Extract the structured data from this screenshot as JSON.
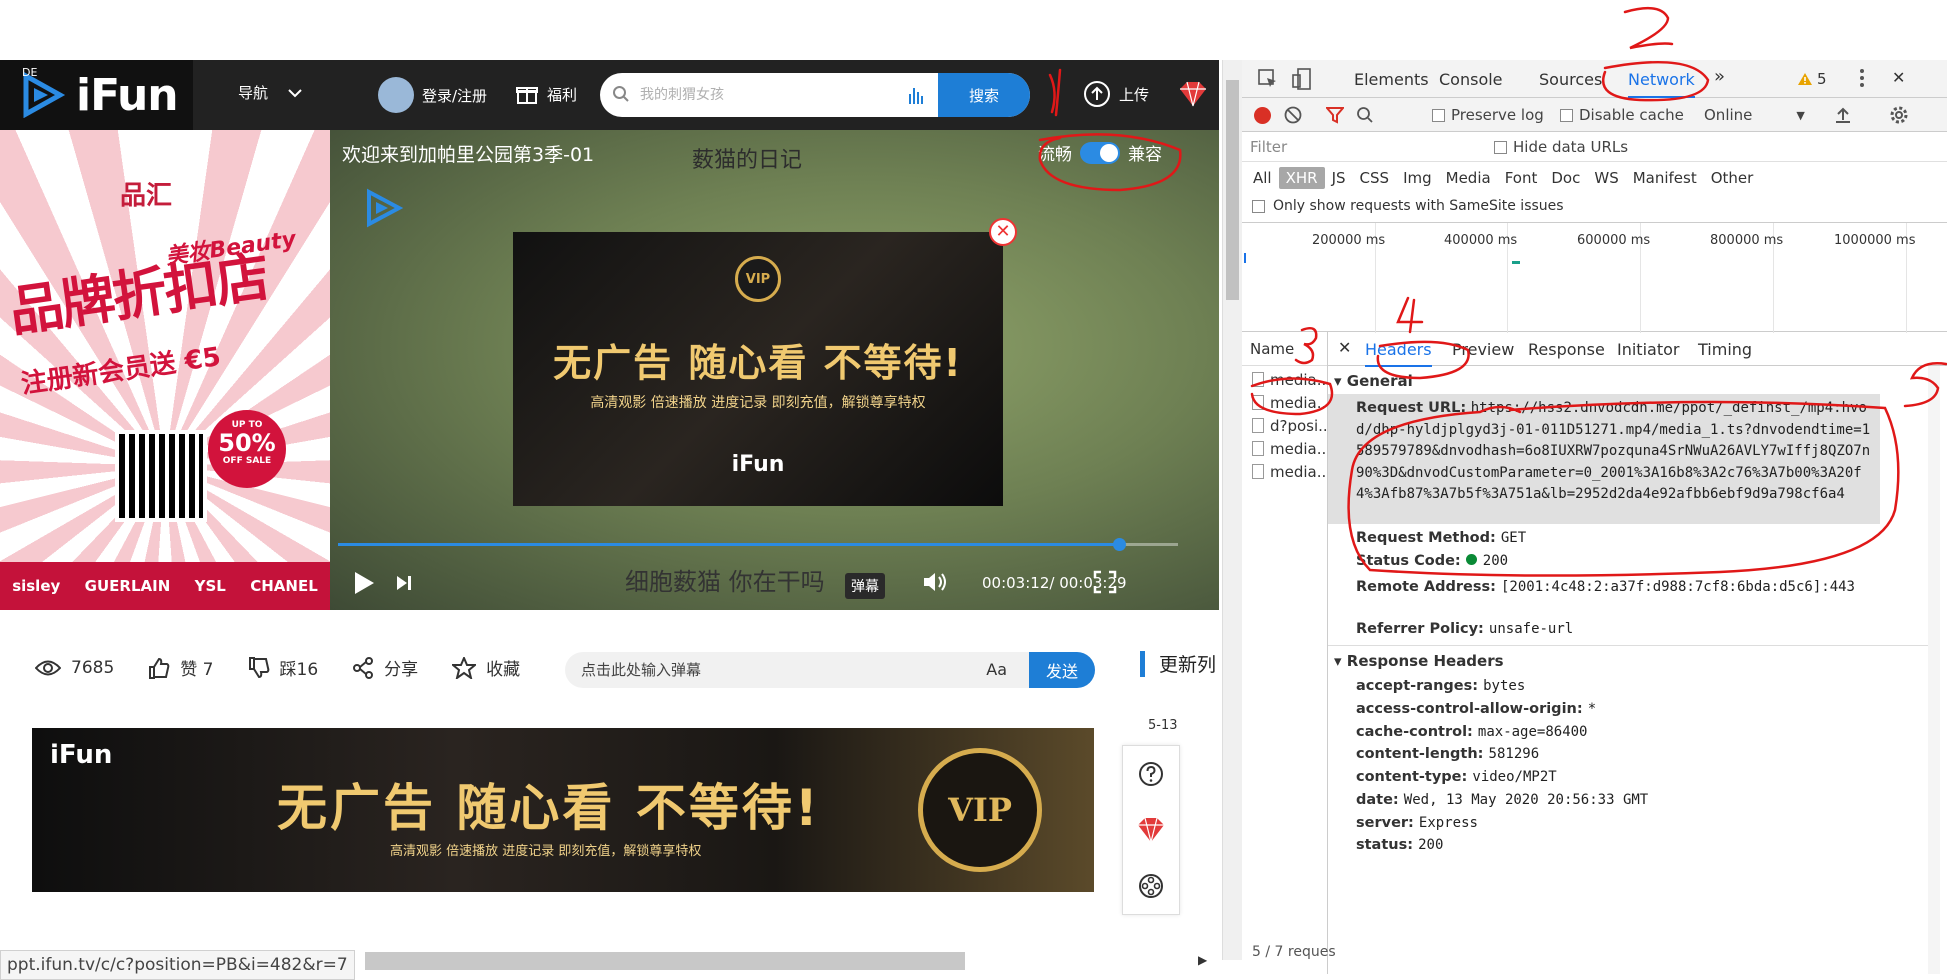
{
  "site": {
    "logo_de": "DE",
    "logo_text": "iFun",
    "nav_label": "导航",
    "login_label": "登录/注册",
    "welfare_label": "福利",
    "search_placeholder": "我的刺猬女孩",
    "search_button": "搜索",
    "upload_label": "上传"
  },
  "ad_left": {
    "brand": "品汇",
    "beauty": "美妆Beauty",
    "headline": "品牌折扣店",
    "promo": "注册新会员送 €5",
    "sale_top": "UP TO",
    "sale_pct": "50%",
    "sale_bottom": "OFF SALE",
    "brands": [
      "sisley",
      "GUERLAIN",
      "YSL",
      "CHANEL"
    ]
  },
  "video": {
    "title": "欢迎来到加帕里公园第3季-01",
    "subtitle_top": "薮猫的日记",
    "mode_smooth": "流畅",
    "mode_compat": "兼容",
    "toggle_on": true,
    "popup_badge": "VIP",
    "popup_headline": "无广告 随心看 不等待!",
    "popup_subline": "高清观影 倍速播放 进度记录 即刻充值，解锁尊享特权",
    "popup_logo": "iFun",
    "subtitle_bottom": "细胞薮猫 你在干吗",
    "danmu_badge": "弹幕",
    "time_current": "00:03:12",
    "time_total": "00:03:29",
    "time_display": "00:03:12/ 00:03:29",
    "progress": 0.93
  },
  "stats": {
    "views": "7685",
    "likes": "赞 7",
    "dislikes": "踩16",
    "share": "分享",
    "favorite": "收藏"
  },
  "danmu": {
    "placeholder": "点击此处输入弹幕",
    "font_label": "Aa",
    "send_label": "发送"
  },
  "side_list": {
    "title": "更新列",
    "dates": [
      "5-13",
      "5-13"
    ]
  },
  "banner": {
    "logo": "iFun",
    "headline": "无广告 随心看 不等待!",
    "subline": "高清观影 倍速播放 进度记录 即刻充值，解锁尊享特权",
    "seal": "VIP"
  },
  "status_bar": {
    "url": "ppt.ifun.tv/c/c?position=PB&i=482&r=7"
  },
  "devtools": {
    "tabs": [
      "Elements",
      "Console",
      "Sources",
      "Network"
    ],
    "more_tabs": "»",
    "warning_count": "5",
    "preserve_log": "Preserve log",
    "disable_cache": "Disable cache",
    "throttle": "Online",
    "filter_placeholder": "Filter",
    "hide_data_urls": "Hide data URLs",
    "types": [
      "All",
      "XHR",
      "JS",
      "CSS",
      "Img",
      "Media",
      "Font",
      "Doc",
      "WS",
      "Manifest",
      "Other"
    ],
    "selected_type": "XHR",
    "samesite_label": "Only show requests with SameSite issues",
    "timeline_labels": [
      "200000 ms",
      "400000 ms",
      "600000 ms",
      "800000 ms",
      "1000000 ms"
    ],
    "name_header": "Name",
    "requests": [
      "media...",
      "media...",
      "d?posi...",
      "media...",
      "media..."
    ],
    "request_count": "5 / 7 reques",
    "detail_tabs": [
      "Headers",
      "Preview",
      "Response",
      "Initiator",
      "Timing"
    ],
    "general_title": "General",
    "request_url_key": "Request URL:",
    "request_url": "https://hss2.dnvodcdn.me/ppot/_definst_/mp4:hvod/dhp-hyldjplgyd3j-01-011D51271.mp4/media_1.ts?dnvodendtime=1589579789&dnvodhash=6o8IUXRW7pozquna4SrNWuA26AVLY7wIffj8QZO7n90%3D&dnvodCustomParameter=0_2001%3A16b8%3A2c76%3A7b00%3A20f4%3Afb87%3A7b5f%3A751a&lb=2952d2da4e92afbb6ebf9d9a798cf6a4",
    "request_method_key": "Request Method:",
    "request_method": "GET",
    "status_code_key": "Status Code:",
    "status_code": "200",
    "remote_address_key": "Remote Address:",
    "remote_address": "[2001:4c48:2:a37f:d988:7cf8:6bda:d5c6]:443",
    "referrer_policy_key": "Referrer Policy:",
    "referrer_policy": "unsafe-url",
    "response_headers_title": "Response Headers",
    "response_headers": [
      {
        "k": "accept-ranges:",
        "v": "bytes"
      },
      {
        "k": "access-control-allow-origin:",
        "v": "*"
      },
      {
        "k": "cache-control:",
        "v": "max-age=86400"
      },
      {
        "k": "content-length:",
        "v": "581296"
      },
      {
        "k": "content-type:",
        "v": "video/MP2T"
      },
      {
        "k": "date:",
        "v": "Wed, 13 May 2020 20:56:33 GMT"
      },
      {
        "k": "server:",
        "v": "Express"
      },
      {
        "k": "status:",
        "v": "200"
      }
    ]
  },
  "annotations": {
    "step1": "1",
    "step2": "2",
    "step3": "3",
    "step4": "4",
    "step5": "5",
    "ink_color": "#e01818"
  },
  "colors": {
    "accent_blue": "#1e7ed6",
    "devtools_blue": "#1a73e8",
    "record_red": "#d93025",
    "status_green": "#0a8a36",
    "vip_gold": "#f0c970"
  }
}
